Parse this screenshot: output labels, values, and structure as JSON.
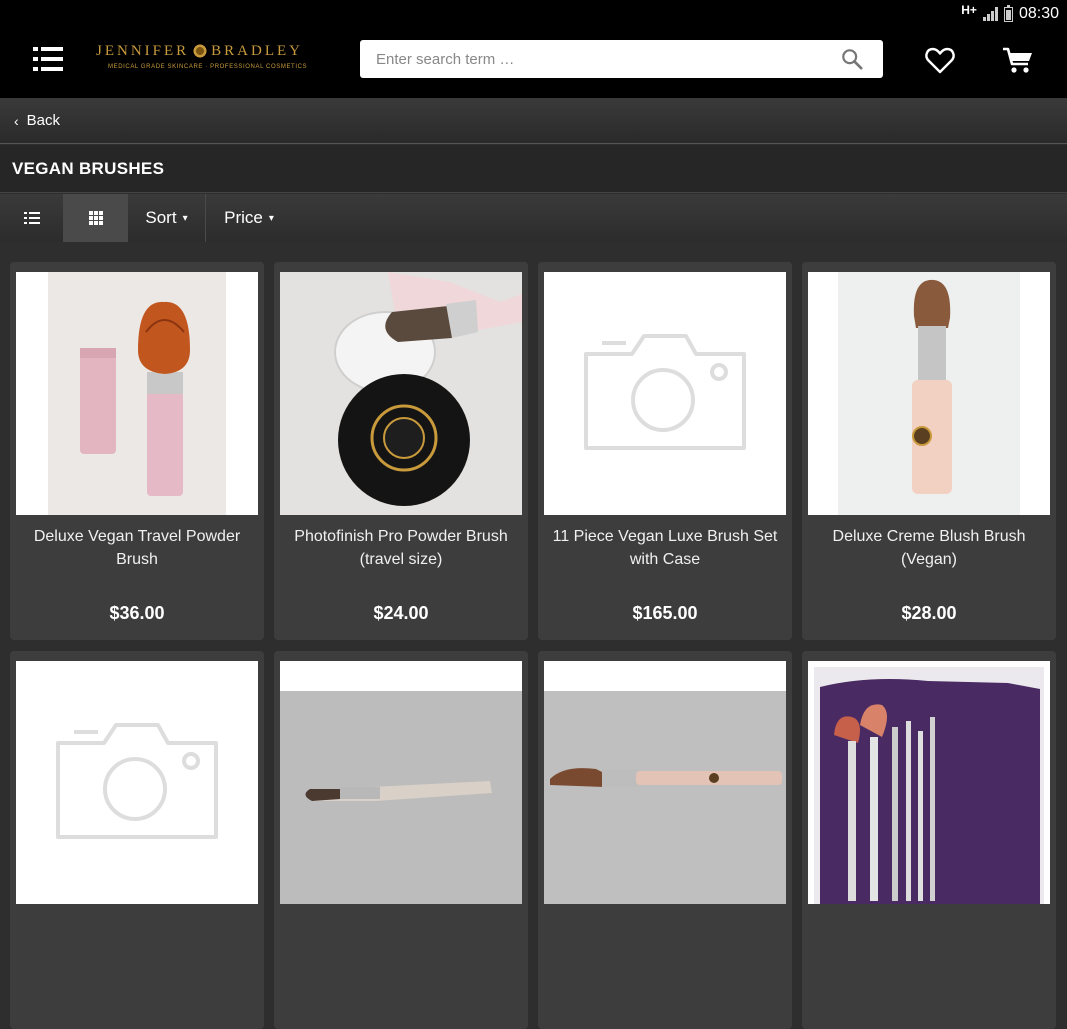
{
  "status": {
    "network": "H+",
    "time": "08:30"
  },
  "header": {
    "brand_name_left": "JENNIFER",
    "brand_name_right": "BRADLEY",
    "brand_tagline": "MEDICAL GRADE SKINCARE  ·  PROFESSIONAL COSMETICS",
    "search_placeholder": "Enter search term …"
  },
  "nav": {
    "back_label": "Back"
  },
  "category": {
    "title": "VEGAN BRUSHES"
  },
  "toolbar": {
    "sort_label": "Sort",
    "price_label": "Price"
  },
  "products": [
    {
      "name": "Deluxe Vegan Travel Powder Brush",
      "price": "$36.00"
    },
    {
      "name": "Photofinish Pro Powder Brush (travel size)",
      "price": "$24.00"
    },
    {
      "name": "11 Piece Vegan Luxe Brush Set with Case",
      "price": "$165.00"
    },
    {
      "name": "Deluxe Creme Blush Brush (Vegan)",
      "price": "$28.00"
    },
    {
      "name": "",
      "price": ""
    },
    {
      "name": "",
      "price": ""
    },
    {
      "name": "",
      "price": ""
    },
    {
      "name": "",
      "price": ""
    }
  ],
  "colors": {
    "brand_gold": "#c79a3d",
    "background": "#2e2e2e",
    "card": "#3d3d3d"
  }
}
